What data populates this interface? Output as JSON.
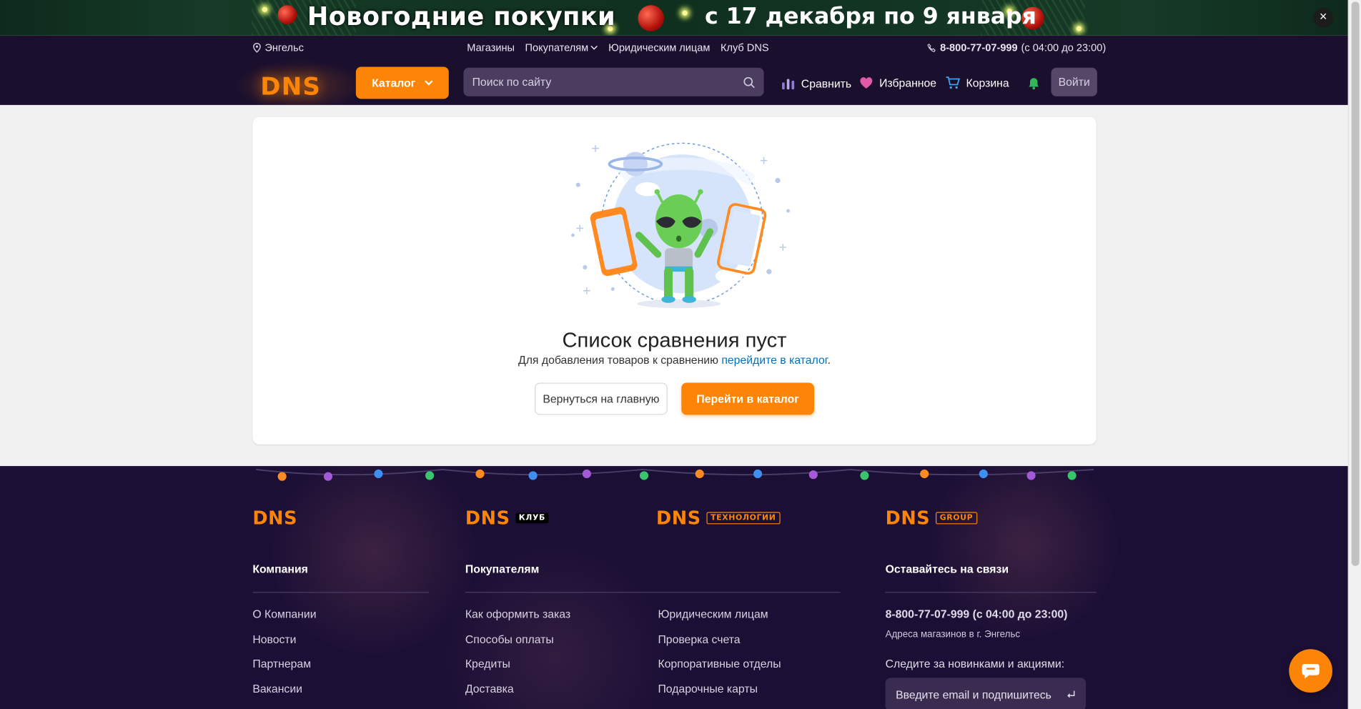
{
  "promo": {
    "title": "Новогодние покупки",
    "dates": "с 17 декабря по 9 января",
    "close_icon": "×"
  },
  "header": {
    "city": "Энгельс",
    "nav": [
      "Магазины",
      "Покупателям",
      "Юридическим лицам",
      "Клуб DNS"
    ],
    "phone": "8-800-77-07-999",
    "phone_hours": "(с 04:00 до 23:00)",
    "logo": "DNS",
    "catalog_label": "Каталог",
    "search_placeholder": "Поиск по сайту",
    "compare_label": "Сравнить",
    "favorites_label": "Избранное",
    "cart_label": "Корзина",
    "login_label": "Войти"
  },
  "empty_state": {
    "title": "Список сравнения пуст",
    "subtitle_prefix": "Для добавления товаров к сравнению ",
    "subtitle_link": "перейдите в каталог",
    "subtitle_suffix": ".",
    "back_label": "Вернуться на главную",
    "catalog_button_label": "Перейти в каталог"
  },
  "footer": {
    "brands": [
      {
        "name": "DNS",
        "tag": ""
      },
      {
        "name": "DNS",
        "tag": "КЛУБ"
      },
      {
        "name": "DNS",
        "tag": "ТЕХНОЛОГИИ"
      },
      {
        "name": "DNS",
        "tag": "GROUP"
      }
    ],
    "columns": [
      {
        "heading": "Компания",
        "links": [
          "О Компании",
          "Новости",
          "Партнерам",
          "Вакансии"
        ]
      },
      {
        "heading": "Покупателям",
        "links": [
          "Как оформить заказ",
          "Способы оплаты",
          "Кредиты",
          "Доставка"
        ]
      },
      {
        "heading": "",
        "links": [
          "Юридическим лицам",
          "Проверка счета",
          "Корпоративные отделы",
          "Подарочные карты"
        ]
      },
      {
        "heading": "Оставайтесь на связи",
        "links": []
      }
    ],
    "contact_phone": "8-800-77-07-999 (с 04:00 до 23:00)",
    "stores_address": "Адреса магазинов в г. Энгельс",
    "subscribe_text": "Следите за новинками и акциями:",
    "email_placeholder": "Введите email и подпишитесь"
  },
  "colors": {
    "accent": "#fc8507",
    "header_bg": "#1b0f2e",
    "footer_bg": "#1c0f35",
    "link": "#0071bf"
  }
}
